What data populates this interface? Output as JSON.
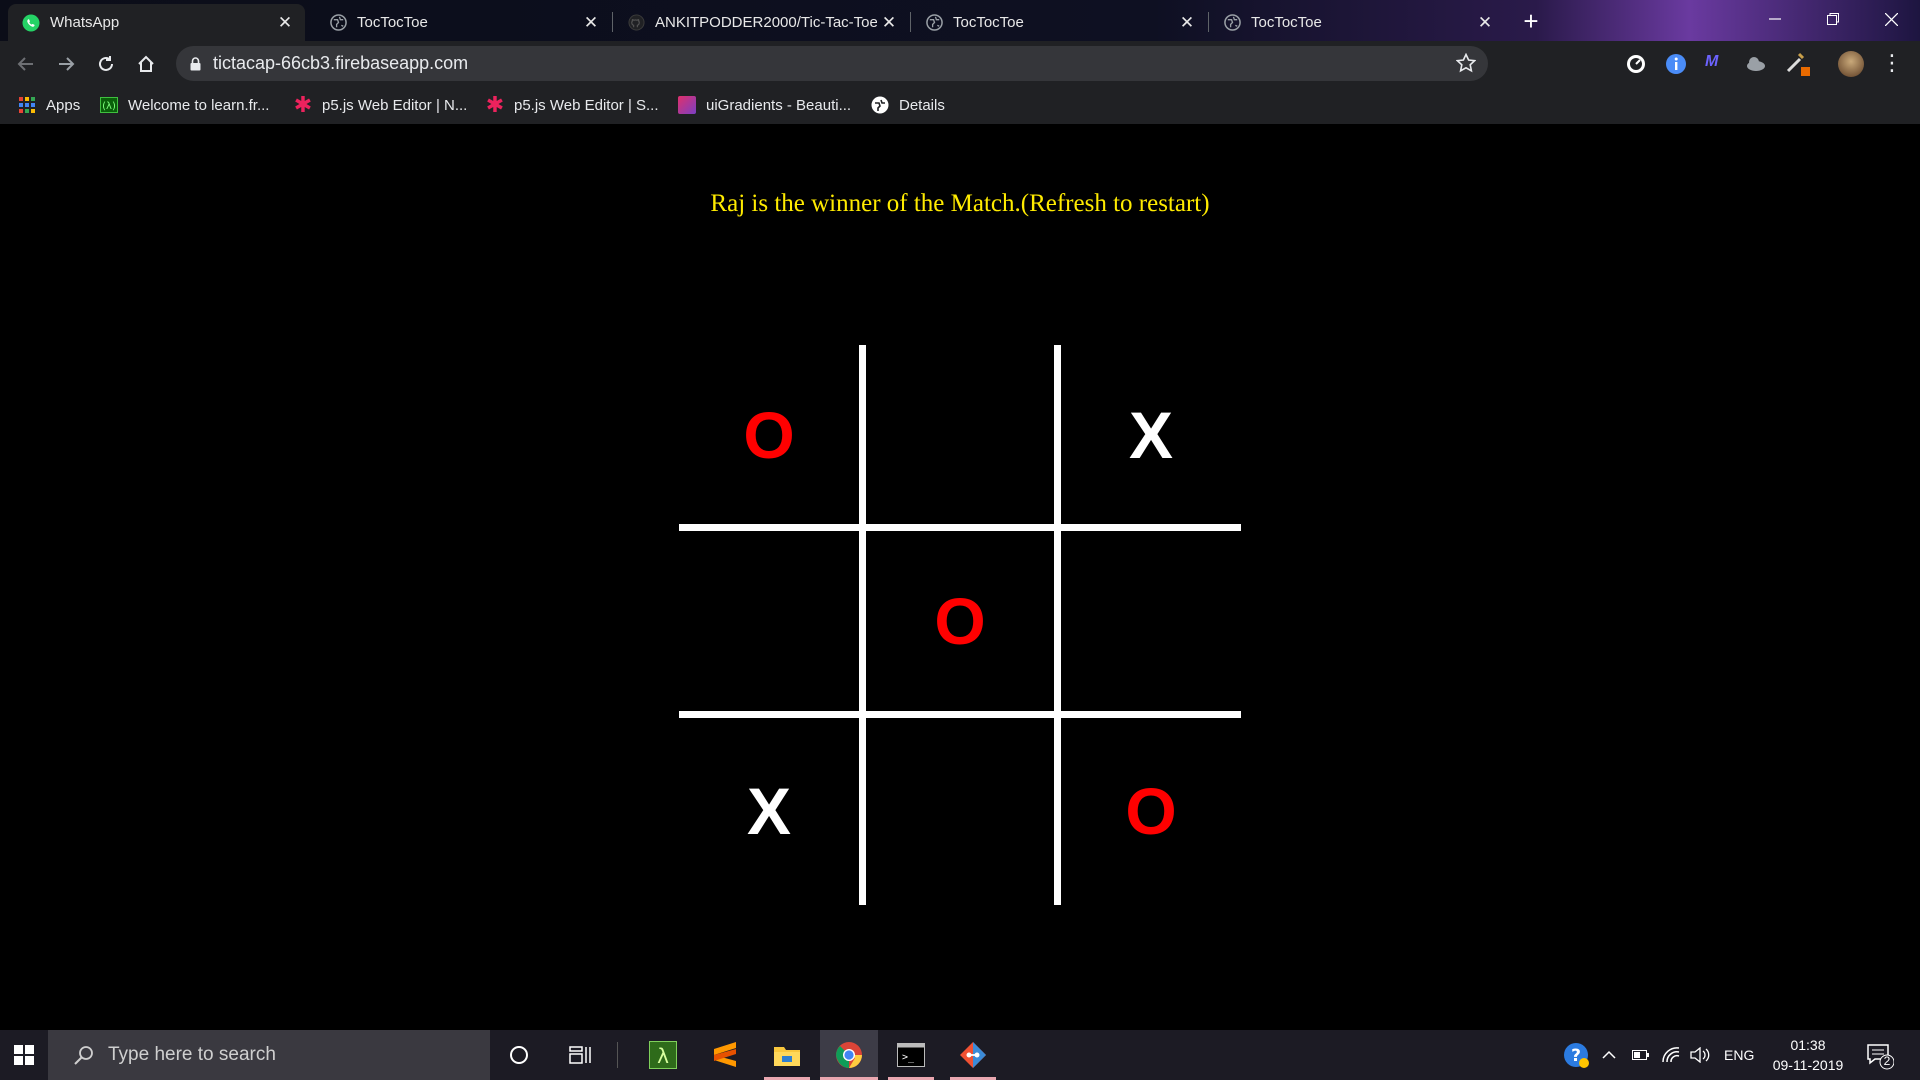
{
  "browser": {
    "tabs": [
      {
        "title": "WhatsApp",
        "icon": "whatsapp-icon",
        "active": true
      },
      {
        "title": "TocTocToe",
        "icon": "globe-icon",
        "active": false
      },
      {
        "title": "ANKITPODDER2000/Tic-Tac-Toe",
        "icon": "github-icon",
        "active": false
      },
      {
        "title": "TocTocToe",
        "icon": "globe-icon",
        "active": false
      },
      {
        "title": "TocTocToe",
        "icon": "globe-icon",
        "active": false
      }
    ],
    "url": "tictacap-66cb3.firebaseapp.com",
    "bookmarks": [
      {
        "label": "Apps",
        "icon": "apps-grid-icon"
      },
      {
        "label": "Welcome to learn.fr...",
        "icon": "learn-icon"
      },
      {
        "label": "p5.js Web Editor | N...",
        "icon": "p5js-icon"
      },
      {
        "label": "p5.js Web Editor | S...",
        "icon": "p5js-icon"
      },
      {
        "label": "uiGradients - Beauti...",
        "icon": "uigradients-icon"
      },
      {
        "label": "Details",
        "icon": "details-icon"
      }
    ]
  },
  "game": {
    "status": "Raj is the winner of the Match.(Refresh to restart)",
    "board": [
      [
        "O",
        "",
        "X"
      ],
      [
        "",
        "O",
        ""
      ],
      [
        "X",
        "",
        "O"
      ]
    ],
    "o_color": "#ff0000",
    "x_color": "#ffffff",
    "status_color": "#ffeb00"
  },
  "taskbar": {
    "search_placeholder": "Type here to search",
    "language": "ENG",
    "time": "01:38",
    "date": "09-11-2019",
    "notifications": "2"
  }
}
